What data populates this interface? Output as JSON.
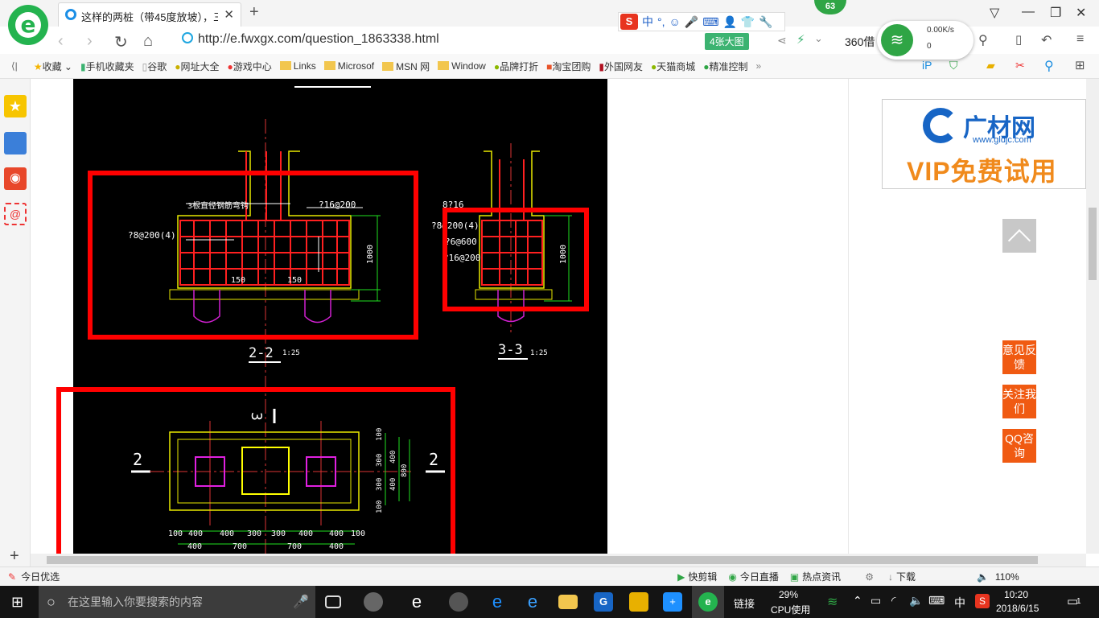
{
  "tab": {
    "title": "这样的两桩（带45度放坡），三"
  },
  "ime": {
    "lang": "中",
    "punct": "°,"
  },
  "badge": "63",
  "address": {
    "url": "http://e.fwxgx.com/question_1863338.html",
    "image_count": "4张大图",
    "search_label": "360借"
  },
  "network": {
    "speed": "0.00K/s",
    "count": "0"
  },
  "bookmarks": [
    "收藏",
    "手机收藏夹",
    "谷歌",
    "网址大全",
    "游戏中心",
    "Links",
    "Microsof",
    "MSN 网",
    "Window",
    "品牌打折",
    "淘宝团购",
    "外国网友",
    "天猫商城",
    "精准控制"
  ],
  "cad": {
    "s22": "2-2",
    "s33": "3-3",
    "scale": "1:25",
    "mark2": "2",
    "mark3": "3",
    "labels": {
      "a": "3根直径钢筋弯钩",
      "b": "?16@200",
      "c": "?8@200(4)",
      "d": "150",
      "e": "1000",
      "f": "8?16",
      "g": "?8@200(4)",
      "h": "?6@600",
      "i": "?16@200",
      "j": "100",
      "k": "1:25"
    },
    "dims_bottom1": [
      "100",
      "400",
      "400",
      "300",
      "300",
      "400",
      "400",
      "100"
    ],
    "dims_bottom2": [
      "400",
      "700",
      "700",
      "400"
    ],
    "dims_right": [
      "100",
      "300",
      "400",
      "400",
      "300",
      "100",
      "800"
    ]
  },
  "ad": {
    "name": "广材网",
    "url": "www.gldjc.com",
    "slogan": "VIP免费试用"
  },
  "float_buttons": [
    "意见反馈",
    "关注我们",
    "QQ咨询"
  ],
  "status": {
    "left": "今日优选",
    "items": [
      "快剪辑",
      "今日直播",
      "热点资讯"
    ],
    "download": "下载",
    "zoom": "110%"
  },
  "taskbar": {
    "search_placeholder": "在这里输入你要搜索的内容",
    "link": "链接",
    "cpu_pct": "29%",
    "cpu_label": "CPU使用",
    "ime": "中",
    "time": "10:20",
    "date": "2018/6/15",
    "notif": "1"
  }
}
